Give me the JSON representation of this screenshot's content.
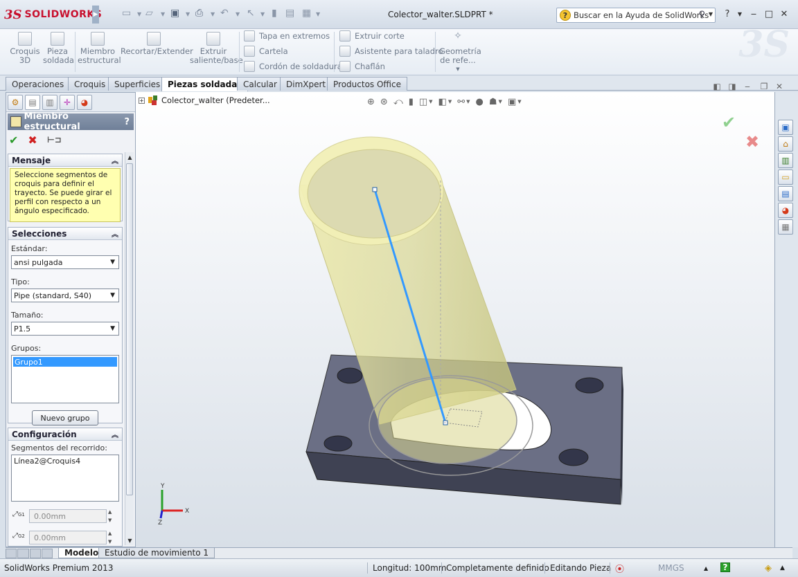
{
  "app": {
    "logo_ds": "3S",
    "logo_text": "SOLIDWORKS",
    "doc_title": "Colector_walter.SLDPRT *"
  },
  "help": {
    "search_placeholder": "Buscar en la Ayuda de SolidWorks"
  },
  "ribbon": {
    "large": [
      {
        "label1": "Croquis",
        "label2": "3D"
      },
      {
        "label1": "Pieza",
        "label2": "soldada"
      },
      {
        "label1": "Miembro",
        "label2": "estructural"
      },
      {
        "label1": "Recortar/Extender",
        "label2": ""
      },
      {
        "label1": "Extruir",
        "label2": "saliente/base"
      }
    ],
    "small_col1": [
      "Tapa en extremos",
      "Cartela",
      "Cordón de soldadura"
    ],
    "small_col2": [
      "Extruir corte",
      "Asistente para taladro",
      "Chaflán"
    ],
    "ref_geom": {
      "label1": "Geometría",
      "label2": "de refe..."
    }
  },
  "tabs": [
    "Operaciones",
    "Croquis",
    "Superficies",
    "Piezas soldadas",
    "Calcular",
    "DimXpert",
    "Productos Office"
  ],
  "pm": {
    "title": "Miembro estructural",
    "help": "?",
    "message_header": "Mensaje",
    "message_text": "Seleccione segmentos de croquis para definir el trayecto. Se puede girar el perfil con respecto a un ángulo especificado.",
    "selections_header": "Selecciones",
    "standard_label": "Estándar:",
    "standard_value": "ansi pulgada",
    "type_label": "Tipo:",
    "type_value": "Pipe (standard, S40)",
    "size_label": "Tamaño:",
    "size_value": "P1.5",
    "groups_label": "Grupos:",
    "group_item": "Grupo1",
    "new_group_button": "Nuevo grupo",
    "config_header": "Configuración",
    "path_label": "Segmentos del recorrido:",
    "path_value": "Línea2@Croquis4",
    "g1_value": "0.00mm",
    "g1_label": "G1",
    "g2_value": "0.00mm",
    "g2_label": "G2"
  },
  "tree": {
    "item": "Colector_walter  (Predeter..."
  },
  "triad": {
    "x": "X",
    "y": "Y",
    "z": "Z"
  },
  "model_tabs": [
    "Modelo",
    "Estudio de movimiento 1"
  ],
  "status": {
    "product": "SolidWorks Premium 2013",
    "length": "Longitud: 100mm",
    "state": "Completamente definido",
    "editing": "Editando Pieza",
    "units": "MMGS"
  },
  "colors": {
    "accent": "#c8102e",
    "sketch_line": "#3399ff",
    "pipe": "#e8e6a0",
    "plate": "#4a4d60",
    "message_bg": "#ffffb0"
  }
}
